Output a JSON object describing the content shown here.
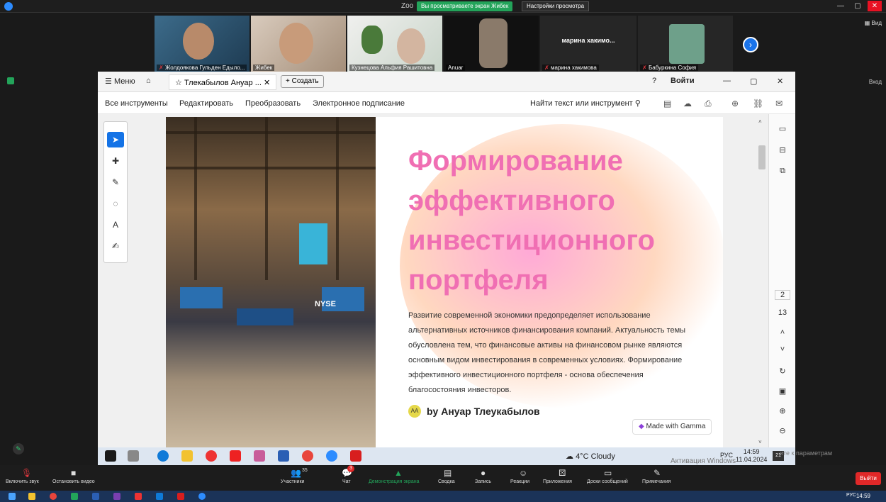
{
  "zoom": {
    "title": "Zoo",
    "share_banner": "Вы просматриваете экран Жибек",
    "view_settings": "Настройки просмотра",
    "view_label": "Вид",
    "enter_label": "Вход",
    "participants": [
      {
        "name": "Жолдоякова Гульден Едыло..."
      },
      {
        "name": "Жибек"
      },
      {
        "name": "Кузнецова Альфия Рашитовна"
      },
      {
        "name": "Anuar"
      },
      {
        "name": "марина хакимова",
        "display": "марина хакимо..."
      },
      {
        "name": "Бабуркина София"
      }
    ],
    "bottom": {
      "mute": "Включить звук",
      "video": "Остановить видео",
      "participants": "Участники",
      "participants_count": "35",
      "chat": "Чат",
      "chat_badge": "3",
      "share": "Демонстрация экрана",
      "summary": "Сводка",
      "record": "Запись",
      "reactions": "Реакции",
      "apps": "Приложения",
      "boards": "Доски сообщений",
      "notes": "Примечания",
      "exit": "Выйти"
    }
  },
  "acrobat": {
    "menu": "Меню",
    "tab_title": "Тлекабылов Ануар ...",
    "create": "Создать",
    "sign_in": "Войти",
    "menubar": [
      "Все инструменты",
      "Редактировать",
      "Преобразовать",
      "Электронное подписание"
    ],
    "find": "Найти текст или инструмент",
    "page_current": "2",
    "page_total": "13"
  },
  "slide": {
    "title": "Формирование эффективного инвестиционного портфеля",
    "body": "Развитие современной экономики предопределяет использование альтернативных источников финансирования компаний. Актуальность темы обусловлена тем, что финансовые активы на финансовом рынке являются основным видом инвестирования в современных условиях. Формирование эффективного инвестиционного портфеля - основа обеспечения благосостояния инвесторов.",
    "author_initials": "AA",
    "author": "by Ануар Тлеукабылов",
    "gamma_badge": "Made with Gamma",
    "photo_sign": "NYSE"
  },
  "taskbar": {
    "weather": "4°C Cloudy",
    "lang": "РУС",
    "time": "14:59",
    "date": "11.04.2024",
    "activate": "Активация Windows",
    "activate_hint": "ите к параметрам",
    "notif_count": "21"
  },
  "win_taskbar": {
    "lang": "РУС",
    "time": "14:59"
  },
  "colors": {
    "zoom_green": "#23a45a",
    "slide_pink": "#f06fb3",
    "acrobat_blue": "#1473e6",
    "exit_red": "#e02828"
  }
}
